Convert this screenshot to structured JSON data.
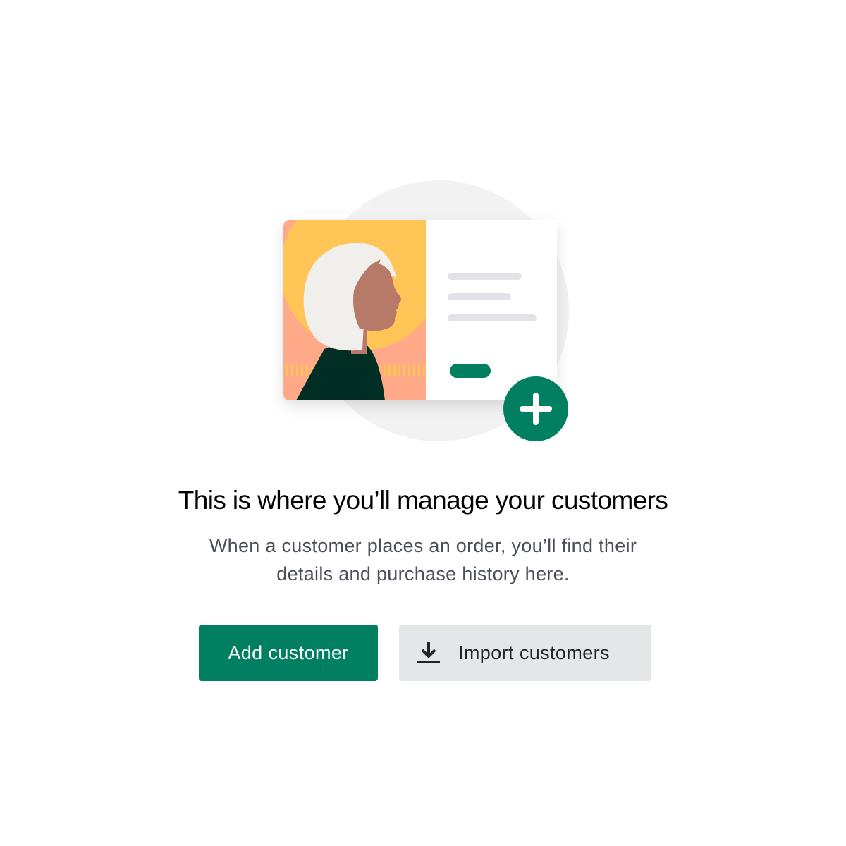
{
  "empty_state": {
    "heading": "This is where you’ll manage your customers",
    "description_line1": "When a customer places an order, you’ll find their",
    "description_line2": "details and purchase history here."
  },
  "actions": {
    "primary_label": "Add customer",
    "secondary_label": "Import customers",
    "secondary_icon": "import-download-icon"
  },
  "illustration": {
    "description_icon": "customer-card-illustration",
    "badge_icon": "plus-circle-icon"
  },
  "colors": {
    "accent_green": "#008060",
    "secondary_button_bg": "#e5e6e8",
    "card_yellow": "#ffc657",
    "card_peach": "#ffa988",
    "skin": "#b77a68",
    "hair": "#f0efec",
    "shirt": "#002e25",
    "background_circle": "#f2f2f3"
  }
}
